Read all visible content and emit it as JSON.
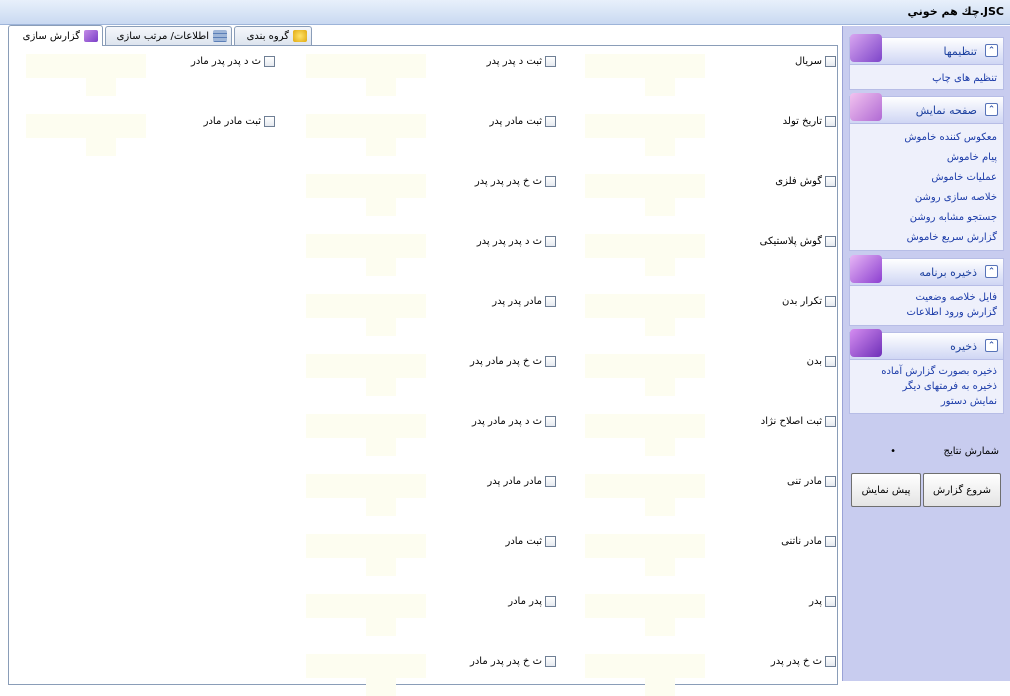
{
  "window": {
    "title": "JSC.چك هم خوني"
  },
  "tabs": [
    {
      "label": "گزارش سازی",
      "icon": "report-icon",
      "active": true
    },
    {
      "label": "اطلاعات/ مرتب سازی",
      "icon": "database-icon",
      "active": false
    },
    {
      "label": "گروه بندی",
      "icon": "group-icon",
      "active": false
    }
  ],
  "fields": {
    "col1": [
      "سریال",
      "تاریخ تولد",
      "گوش فلزی",
      "گوش پلاستیکی",
      "تکرار بدن",
      "بدن",
      "ثبت اصلاح نژاد",
      "مادر تنی",
      "مادر ناتنی",
      "پدر",
      "ث خ پدر پدر"
    ],
    "col2": [
      "ثبت د پدر پدر",
      "ثبت مادر پدر",
      "ث خ پدر پدر پدر",
      "ث د پدر پدر پدر",
      "مادر پدر پدر",
      "ث خ پدر مادر پدر",
      "ث د پدر مادر پدر",
      "مادر مادر پدر",
      "ثبت مادر",
      "پدر مادر",
      "ث خ پدر پدر مادر"
    ],
    "col3": [
      "ث د پدر پدر مادر",
      "ثبت مادر مادر"
    ]
  },
  "sidebar": {
    "groups": [
      {
        "title": "تنظیمها",
        "items": [
          "تنظیم های چاپ"
        ]
      },
      {
        "title": "صفحه نمایش",
        "items": [
          "معکوس کننده خاموش",
          "پیام خاموش",
          "عملیات خاموش",
          "خلاصه سازی روشن",
          "جستجو مشابه روشن",
          "گزارش سریع خاموش"
        ]
      },
      {
        "title": "ذخیره برنامه",
        "items": [
          "فایل خلاصه وضعیت",
          "گزارش ورود اطلاعات"
        ]
      },
      {
        "title": "ذخیره",
        "items": [
          "ذخیره بصورت گزارش آماده",
          "ذخیره به فرمتهای دیگر",
          "نمایش دستور"
        ]
      }
    ],
    "count_label": "شمارش نتایج",
    "count_value": "•",
    "start_button": "شروع گزارش",
    "preview_button": "پیش نمایش"
  },
  "colors": {
    "sidebar_bg": "#c8ccef",
    "link": "#1a3aa8",
    "slot_bg": "#fdfdf0"
  }
}
